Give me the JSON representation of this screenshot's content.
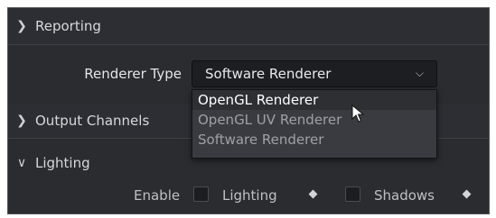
{
  "sections": {
    "reporting": {
      "label": "Reporting",
      "expanded": false
    },
    "output_channels": {
      "label": "Output Channels",
      "expanded": false
    },
    "lighting": {
      "label": "Lighting",
      "expanded": true
    }
  },
  "renderer": {
    "label": "Renderer Type",
    "selected": "Software Renderer",
    "options": [
      "OpenGL Renderer",
      "OpenGL UV Renderer",
      "Software Renderer"
    ],
    "hovered": "OpenGL Renderer"
  },
  "enable": {
    "label": "Enable",
    "lighting_label": "Lighting",
    "shadows_label": "Shadows",
    "lighting_checked": false,
    "shadows_checked": false
  },
  "icons": {
    "collapsed": "chevron-right-icon",
    "expanded": "chevron-down-icon",
    "select": "caret-down-icon",
    "keyframe": "diamond-icon",
    "pointer": "mouse-pointer-icon"
  }
}
